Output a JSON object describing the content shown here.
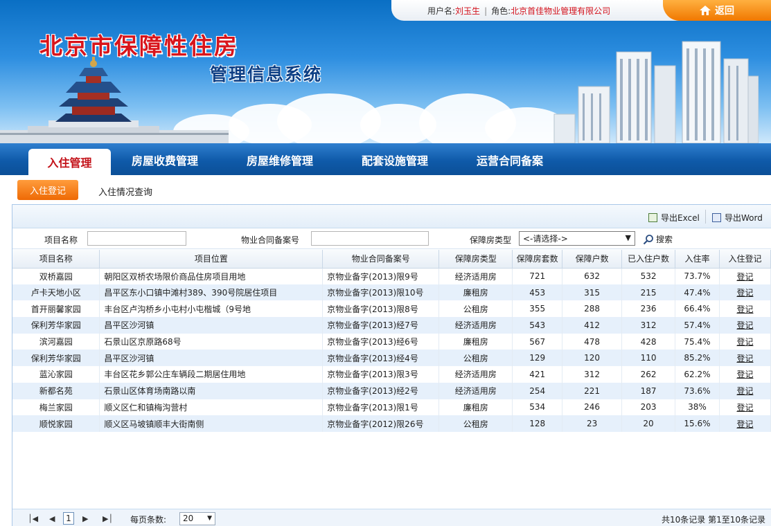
{
  "header": {
    "title_main": "北京市保障性住房",
    "title_sub": "管理信息系统",
    "user_label": "用户名:",
    "user_name": "刘玉生",
    "role_label": "角色:",
    "role_name": "北京首佳物业管理有限公司",
    "back_label": "返回"
  },
  "nav": {
    "items": [
      "入住管理",
      "房屋收费管理",
      "房屋维修管理",
      "配套设施管理",
      "运营合同备案"
    ]
  },
  "subnav": {
    "active": "入住登记",
    "other": "入住情况查询"
  },
  "toolbar": {
    "export_excel": "导出Excel",
    "export_word": "导出Word"
  },
  "search": {
    "project_name_label": "项目名称",
    "project_name_value": "",
    "contract_label": "物业合同备案号",
    "contract_value": "",
    "type_label": "保障房类型",
    "type_selected": "<-请选择->",
    "search_button": "搜索"
  },
  "table": {
    "columns": [
      "项目名称",
      "项目位置",
      "物业合同备案号",
      "保障房类型",
      "保障房套数",
      "保障户数",
      "已入住户数",
      "入住率",
      "入住登记"
    ],
    "rows": [
      [
        "双桥嘉园",
        "朝阳区双桥农场限价商品住房项目用地",
        "京物业备字(2013)限9号",
        "经济适用房",
        "721",
        "632",
        "532",
        "73.7%",
        "登记"
      ],
      [
        "卢卡天地小区",
        "昌平区东小口镇中滩村389、390号院居住项目",
        "京物业备字(2013)限10号",
        "廉租房",
        "453",
        "315",
        "215",
        "47.4%",
        "登记"
      ],
      [
        "首开丽馨家园",
        "丰台区卢沟桥乡小屯村小屯楷城（9号地",
        "京物业备字(2013)限8号",
        "公租房",
        "355",
        "288",
        "236",
        "66.4%",
        "登记"
      ],
      [
        "保利芳华家园",
        "昌平区沙河镇",
        "京物业备字(2013)经7号",
        "经济适用房",
        "543",
        "412",
        "312",
        "57.4%",
        "登记"
      ],
      [
        "滨河嘉园",
        "石景山区京原路68号",
        "京物业备字(2013)经6号",
        "廉租房",
        "567",
        "478",
        "428",
        "75.4%",
        "登记"
      ],
      [
        "保利芳华家园",
        "昌平区沙河镇",
        "京物业备字(2013)经4号",
        "公租房",
        "129",
        "120",
        "110",
        "85.2%",
        "登记"
      ],
      [
        "蓝沁家园",
        "丰台区花乡郭公庄车辆段二期居住用地",
        "京物业备字(2013)限3号",
        "经济适用房",
        "421",
        "312",
        "262",
        "62.2%",
        "登记"
      ],
      [
        "新都名苑",
        "石景山区体育场南路以南",
        "京物业备字(2013)经2号",
        "经济适用房",
        "254",
        "221",
        "187",
        "73.6%",
        "登记"
      ],
      [
        "梅兰家园",
        "顺义区仁和镇梅沟营村",
        "京物业备字(2013)限1号",
        "廉租房",
        "534",
        "246",
        "203",
        "38%",
        "登记"
      ],
      [
        "顺悦家园",
        "顺义区马坡镇顺丰大街南侧",
        "京物业备字(2012)限26号",
        "公租房",
        "128",
        "23",
        "20",
        "15.6%",
        "登记"
      ]
    ]
  },
  "pager": {
    "current_page": "1",
    "page_size_label": "每页条数:",
    "page_size": "20",
    "summary": "共10条记录  第1至10条记录"
  }
}
